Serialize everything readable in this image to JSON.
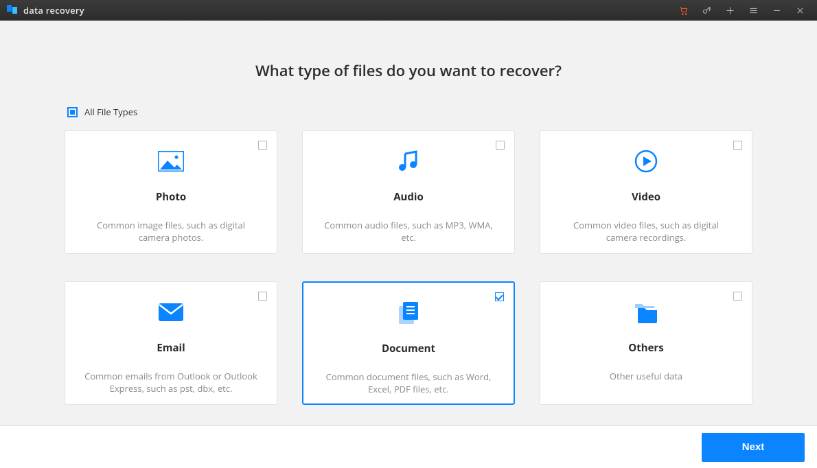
{
  "app": {
    "title": "data recovery"
  },
  "titlebar_icons": {
    "cart": "cart-icon",
    "key": "key-icon",
    "plus": "plus-icon",
    "menu": "menu-icon",
    "minimize": "minimize-icon",
    "close": "close-icon"
  },
  "heading": "What type of files do you want to recover?",
  "all_types": {
    "label": "All File Types",
    "state": "mixed"
  },
  "cards": [
    {
      "key": "photo",
      "title": "Photo",
      "desc": "Common image files, such as digital camera photos.",
      "selected": false
    },
    {
      "key": "audio",
      "title": "Audio",
      "desc": "Common audio files, such as MP3, WMA, etc.",
      "selected": false
    },
    {
      "key": "video",
      "title": "Video",
      "desc": "Common video files, such as digital camera recordings.",
      "selected": false
    },
    {
      "key": "email",
      "title": "Email",
      "desc": "Common emails from Outlook or Outlook Express, such as pst, dbx, etc.",
      "selected": false
    },
    {
      "key": "document",
      "title": "Document",
      "desc": "Common document files, such as Word, Excel, PDF files, etc.",
      "selected": true
    },
    {
      "key": "others",
      "title": "Others",
      "desc": "Other useful data",
      "selected": false
    }
  ],
  "footer": {
    "next": "Next"
  },
  "accent": "#0a84ff"
}
